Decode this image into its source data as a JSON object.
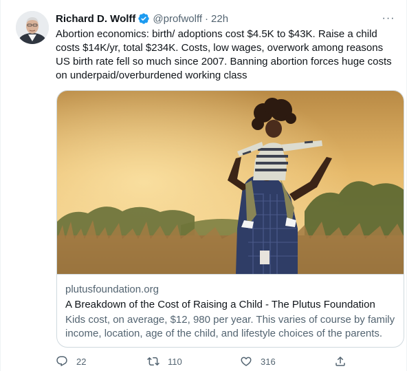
{
  "tweet": {
    "author_name": "Richard D. Wolff",
    "author_handle": "@profwolff",
    "separator": "·",
    "time": "22h",
    "verified_icon": "verified-badge-icon",
    "avatar_icon": "avatar",
    "more_icon": "more-options-icon",
    "more_label": "···",
    "text": "Abortion economics: birth/ adoptions cost $4.5K to $43K. Raise a child costs $14K/yr, total $234K. Costs, low wages, overwork  among reasons US birth rate fell so much since 2007. Banning abortion forces huge costs on underpaid/overburdened working class"
  },
  "card": {
    "domain": "plutusfoundation.org",
    "title": "A Breakdown of the Cost of Raising a Child - The Plutus Foundation",
    "description": "Kids cost, on average, $12, 980 per year. This varies of course by family income, location, age of the child, and lifestyle choices of the parents."
  },
  "actions": {
    "reply_count": "22",
    "retweet_count": "110",
    "like_count": "316"
  },
  "colors": {
    "verified": "#1d9bf0",
    "muted": "#536471",
    "text": "#0f1419",
    "border": "#cfd9de"
  }
}
